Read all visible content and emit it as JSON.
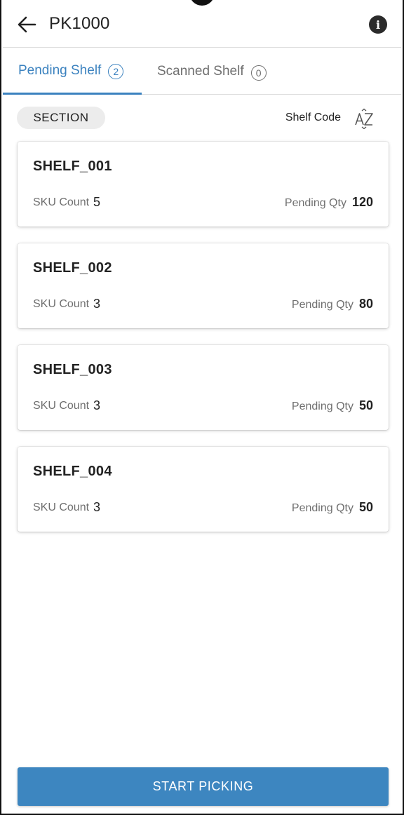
{
  "header": {
    "title": "PK1000",
    "back_icon": "arrow-left-icon",
    "info_icon": "info-icon",
    "info_glyph": "i"
  },
  "tabs": [
    {
      "label": "Pending Shelf",
      "count": "2",
      "active": true
    },
    {
      "label": "Scanned Shelf",
      "count": "0",
      "active": false
    }
  ],
  "filter": {
    "chip_label": "SECTION",
    "sort_label": "Shelf Code",
    "sort_icon": "sort-alpha-icon"
  },
  "labels": {
    "sku_count": "SKU Count",
    "pending_qty": "Pending Qty"
  },
  "shelves": [
    {
      "code": "SHELF_001",
      "sku_count": "5",
      "pending_qty": "120"
    },
    {
      "code": "SHELF_002",
      "sku_count": "3",
      "pending_qty": "80"
    },
    {
      "code": "SHELF_003",
      "sku_count": "3",
      "pending_qty": "50"
    },
    {
      "code": "SHELF_004",
      "sku_count": "3",
      "pending_qty": "50"
    }
  ],
  "action": {
    "label": "START PICKING"
  },
  "colors": {
    "accent": "#3b82bf",
    "button": "#3d86c0",
    "muted_text": "#6f6f6f"
  }
}
